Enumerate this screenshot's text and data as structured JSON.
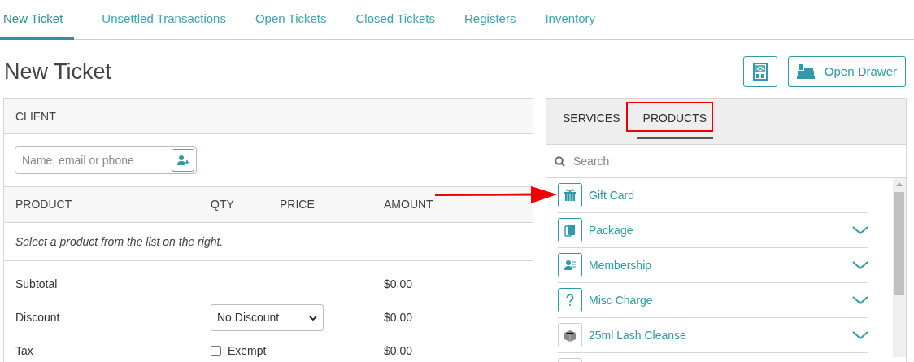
{
  "tabs": [
    {
      "label": "New Ticket",
      "selected": true
    },
    {
      "label": "Unsettled Transactions",
      "selected": false
    },
    {
      "label": "Open Tickets",
      "selected": false
    },
    {
      "label": "Closed Tickets",
      "selected": false
    },
    {
      "label": "Registers",
      "selected": false
    },
    {
      "label": "Inventory",
      "selected": false
    }
  ],
  "page_title": "New Ticket",
  "toolbar": {
    "open_drawer": "Open Drawer"
  },
  "ticket": {
    "client_heading": "CLIENT",
    "client_search": {
      "placeholder": "Name, email or phone"
    },
    "columns": [
      "PRODUCT",
      "QTY",
      "PRICE",
      "AMOUNT"
    ],
    "empty_message": "Select a product from the list on the right.",
    "totals": [
      {
        "kind": "plain",
        "label": "Subtotal",
        "amount": "$0.00"
      },
      {
        "kind": "select",
        "label": "Discount",
        "value": "No Discount",
        "amount": "$0.00"
      },
      {
        "kind": "checkbox",
        "label": "Tax",
        "option": "Exempt",
        "checked": false,
        "amount": "$0.00"
      }
    ]
  },
  "catalog": {
    "tabs": [
      {
        "label": "SERVICES",
        "selected": false
      },
      {
        "label": "PRODUCTS",
        "selected": true
      }
    ],
    "search": {
      "placeholder": "Search"
    },
    "items": [
      {
        "kind": "gift",
        "label": "Gift Card",
        "expandable": false
      },
      {
        "kind": "package",
        "label": "Package",
        "expandable": true
      },
      {
        "kind": "membership",
        "label": "Membership",
        "expandable": true
      },
      {
        "kind": "misc",
        "label": "Misc Charge",
        "expandable": true
      },
      {
        "kind": "product",
        "label": "25ml Lash Cleanse",
        "expandable": true
      }
    ]
  }
}
